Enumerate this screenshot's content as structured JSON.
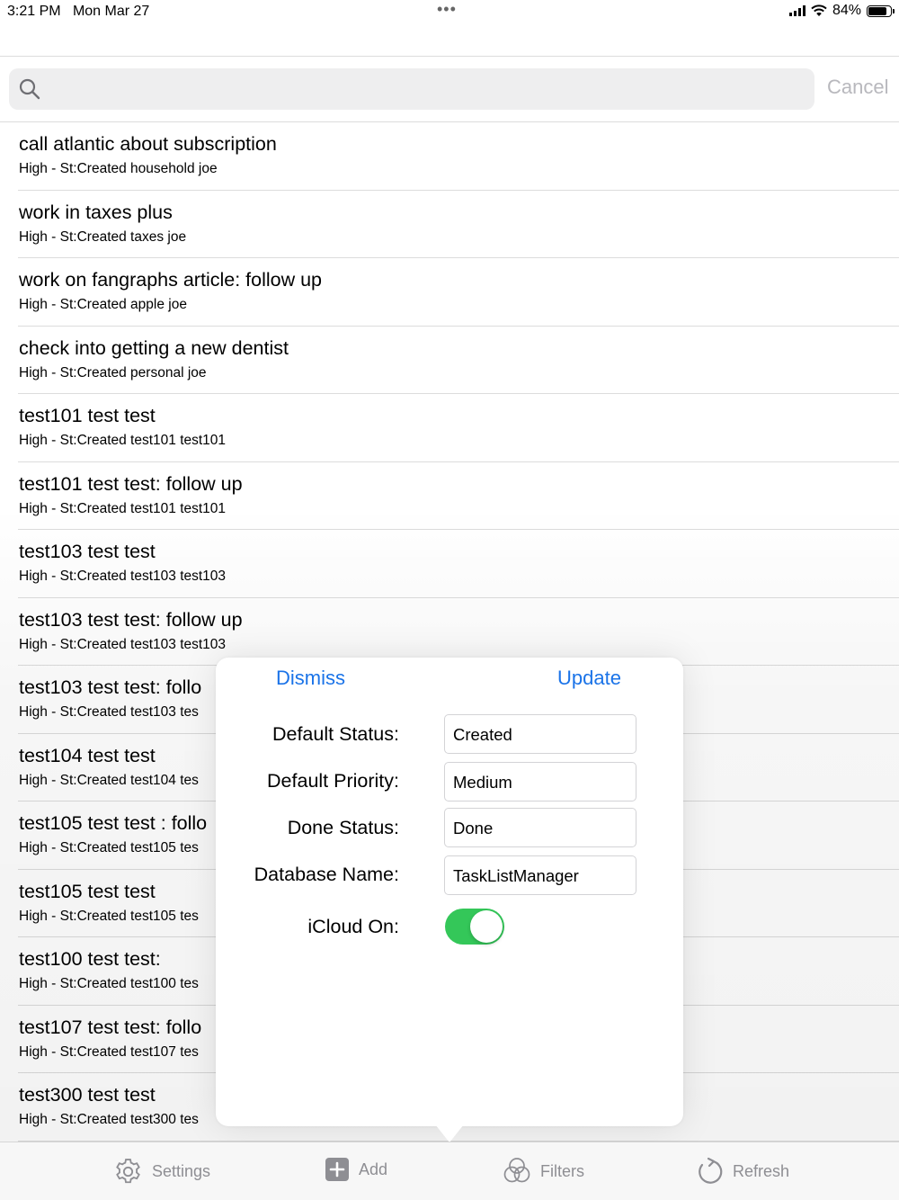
{
  "status_bar": {
    "time": "3:21 PM",
    "date": "Mon Mar 27",
    "multitask_dots": "•••",
    "battery_percent": "84%",
    "battery_level": 0.84,
    "icons": [
      "cellular-signal-icon",
      "wifi-icon",
      "battery-icon"
    ]
  },
  "search": {
    "placeholder": "",
    "value": "",
    "cancel_label": "Cancel",
    "icon": "search-icon"
  },
  "tasks": [
    {
      "title": "call atlantic about subscription",
      "subtitle": "High - St:Created household  joe"
    },
    {
      "title": "work in taxes plus",
      "subtitle": "High - St:Created taxes  joe"
    },
    {
      "title": "work on fangraphs article: follow up",
      "subtitle": "High - St:Created apple  joe"
    },
    {
      "title": "check into getting a new dentist",
      "subtitle": "High - St:Created personal  joe"
    },
    {
      "title": "test101 test test",
      "subtitle": "High - St:Created test101  test101"
    },
    {
      "title": "test101 test test: follow up",
      "subtitle": "High - St:Created test101  test101"
    },
    {
      "title": "test103 test test",
      "subtitle": "High - St:Created test103  test103"
    },
    {
      "title": "test103 test test: follow up",
      "subtitle": "High - St:Created test103  test103"
    },
    {
      "title": "test103 test test: follo",
      "subtitle": "High - St:Created test103  tes"
    },
    {
      "title": "test104 test test",
      "subtitle": "High - St:Created test104  tes"
    },
    {
      "title": "test105 test test : follo",
      "subtitle": "High - St:Created test105  tes"
    },
    {
      "title": "test105 test test",
      "subtitle": "High - St:Created test105  tes"
    },
    {
      "title": "test100 test test: ",
      "subtitle": "High - St:Created test100  tes"
    },
    {
      "title": "test107 test test: follo",
      "subtitle": "High - St:Created test107  tes"
    },
    {
      "title": "test300 test test",
      "subtitle": "High - St:Created test300  tes"
    }
  ],
  "settings_popover": {
    "dismiss_label": "Dismiss",
    "update_label": "Update",
    "fields": {
      "default_status": {
        "label": "Default Status:",
        "value": "Created"
      },
      "default_priority": {
        "label": "Default Priority:",
        "value": "Medium"
      },
      "done_status": {
        "label": "Done Status:",
        "value": "Done"
      },
      "database_name": {
        "label": "Database Name:",
        "value": "TaskListManager"
      }
    },
    "icloud": {
      "label": "iCloud On:",
      "on": true
    },
    "toggle_on_color": "#34c759"
  },
  "tab_bar": {
    "settings": {
      "label": "Settings",
      "icon": "gear-icon"
    },
    "add": {
      "label": "Add",
      "icon": "plus-square-icon"
    },
    "filters": {
      "label": "Filters",
      "icon": "filters-circles-icon"
    },
    "refresh": {
      "label": "Refresh",
      "icon": "refresh-arrow-icon"
    }
  },
  "colors": {
    "accent": "#1a73e8",
    "inactive": "#8e8e93",
    "separator": "#dcdcdc"
  }
}
